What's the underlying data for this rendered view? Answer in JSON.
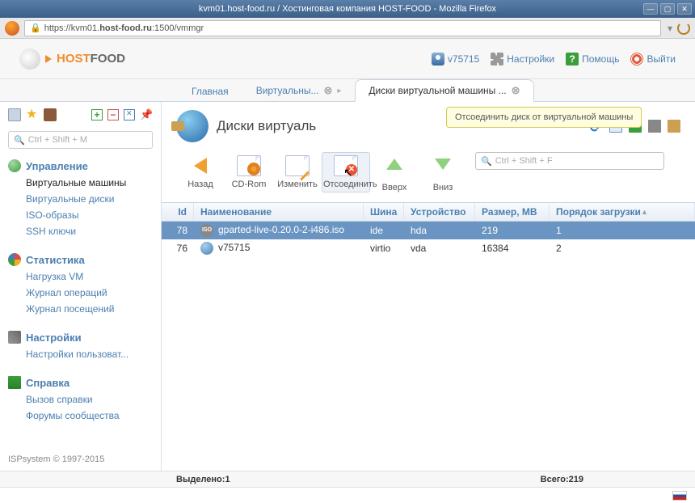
{
  "window_title": "kvm01.host-food.ru / Хостинговая компания HOST-FOOD - Mozilla Firefox",
  "url_prefix": "https://kvm01.",
  "url_host": "host-food.ru",
  "url_suffix": ":1500/vmmgr",
  "logo": {
    "host": "HOST",
    "food": "FOOD"
  },
  "header_links": {
    "user": "v75715",
    "settings": "Настройки",
    "help": "Помощь",
    "exit": "Выйти"
  },
  "tabs": {
    "home": "Главная",
    "vm": "Виртуальны...",
    "disks": "Диски виртуальной машины ..."
  },
  "side_search": "Ctrl + Shift + M",
  "sidebar": {
    "manage": {
      "head": "Управление",
      "vm": "Виртуальные машины",
      "disks": "Виртуальные диски",
      "iso": "ISO-образы",
      "ssh": "SSH ключи"
    },
    "stats": {
      "head": "Статистика",
      "load": "Нагрузка VM",
      "oplog": "Журнал операций",
      "vislog": "Журнал посещений"
    },
    "settings": {
      "head": "Настройки",
      "user": "Настройки пользоват..."
    },
    "help": {
      "head": "Справка",
      "call": "Вызов справки",
      "forums": "Форумы сообщества"
    }
  },
  "footer_copy": "ISPsystem © 1997-2015",
  "page_title": "Диски виртуаль",
  "tooltip": "Отсоединить диск от виртуальной машины",
  "actions": {
    "back": "Назад",
    "cdrom": "CD-Rom",
    "edit": "Изменить",
    "unlink": "Отсоединить",
    "up": "Вверх",
    "down": "Вниз"
  },
  "action_search": "Ctrl + Shift + F",
  "columns": {
    "id": "Id",
    "name": "Наименование",
    "bus": "Шина",
    "dev": "Устройство",
    "size": "Размер, МВ",
    "order": "Порядок загрузки"
  },
  "rows": [
    {
      "id": "78",
      "name": "gparted-live-0.20.0-2-i486.iso",
      "bus": "ide",
      "dev": "hda",
      "size": "219",
      "order": "1",
      "icon": "iso"
    },
    {
      "id": "76",
      "name": "v75715",
      "bus": "virtio",
      "dev": "vda",
      "size": "16384",
      "order": "2",
      "icon": "world"
    }
  ],
  "status": {
    "selected_lbl": "Выделено: ",
    "selected_val": "1",
    "total_lbl": "Всего: ",
    "total_val": "219"
  }
}
